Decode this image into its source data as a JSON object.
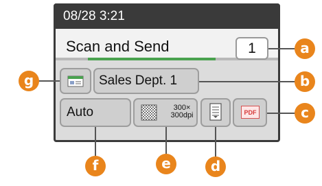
{
  "status_bar": {
    "datetime": "08/28 3:21"
  },
  "mode": {
    "label": "Scan and Send",
    "copies": "1"
  },
  "destination": {
    "name": "Sales Dept. 1",
    "type_icon": "address-book-icon"
  },
  "settings": {
    "color_mode": "Auto",
    "resolution_line1": "300×",
    "resolution_line2": "300dpi",
    "resolution_icon": "resolution-icon",
    "original_type_icon": "document-orientation-icon",
    "file_format": "PDF"
  },
  "callouts": {
    "a": "a",
    "b": "b",
    "c": "c",
    "d": "d",
    "e": "e",
    "f": "f",
    "g": "g"
  },
  "colors": {
    "marker": "#e9851c",
    "statusbar": "#3a3a3a",
    "progress": "#4aa24f"
  }
}
